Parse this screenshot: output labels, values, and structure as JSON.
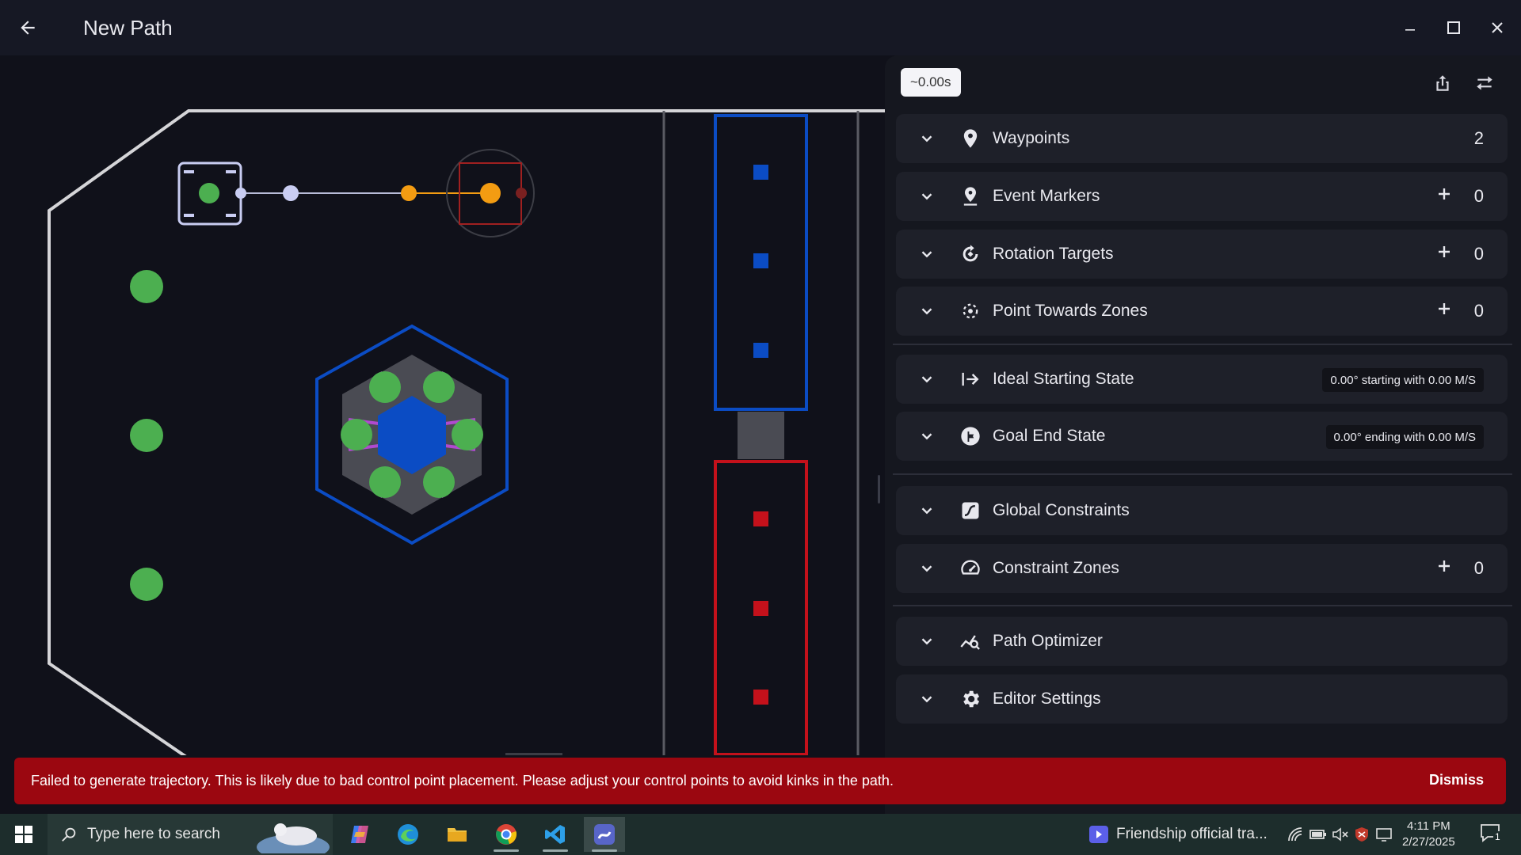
{
  "window": {
    "title": "New Path"
  },
  "panel": {
    "time_estimate": "~0.00s",
    "sections": [
      {
        "id": "waypoints",
        "label": "Waypoints",
        "count": "2",
        "icon": "location-pin-icon"
      },
      {
        "id": "event-markers",
        "label": "Event Markers",
        "count": "0",
        "icon": "event-marker-icon"
      },
      {
        "id": "rotation-targets",
        "label": "Rotation Targets",
        "count": "0",
        "icon": "rotation-icon"
      },
      {
        "id": "point-towards-zones",
        "label": "Point Towards Zones",
        "count": "0",
        "icon": "point-towards-icon"
      },
      {
        "id": "ideal-starting-state",
        "label": "Ideal Starting State",
        "summary": "0.00° starting with 0.00 M/S",
        "icon": "start-arrow-icon"
      },
      {
        "id": "goal-end-state",
        "label": "Goal End State",
        "summary": "0.00° ending with 0.00 M/S",
        "icon": "flag-icon"
      },
      {
        "id": "global-constraints",
        "label": "Global Constraints",
        "icon": "constraints-icon"
      },
      {
        "id": "constraint-zones",
        "label": "Constraint Zones",
        "count": "0",
        "icon": "speedometer-icon"
      },
      {
        "id": "path-optimizer",
        "label": "Path Optimizer",
        "icon": "optimizer-icon"
      },
      {
        "id": "editor-settings",
        "label": "Editor Settings",
        "icon": "gear-icon"
      }
    ]
  },
  "error": {
    "message": "Failed to generate trajectory. This is likely due to bad control point placement. Please adjust your control points to avoid kinks in the path.",
    "action": "Dismiss"
  },
  "taskbar": {
    "search_placeholder": "Type here to search",
    "media_title": "Friendship official tra...",
    "time": "4:11 PM",
    "date": "2/27/2025",
    "notification_count": "1"
  },
  "colors": {
    "accent_blue": "#0b4cc4",
    "alliance_red": "#c4111b",
    "waypoint_start": "#4caf50",
    "waypoint_end": "#f39c12",
    "error_bg": "#9b0710"
  }
}
